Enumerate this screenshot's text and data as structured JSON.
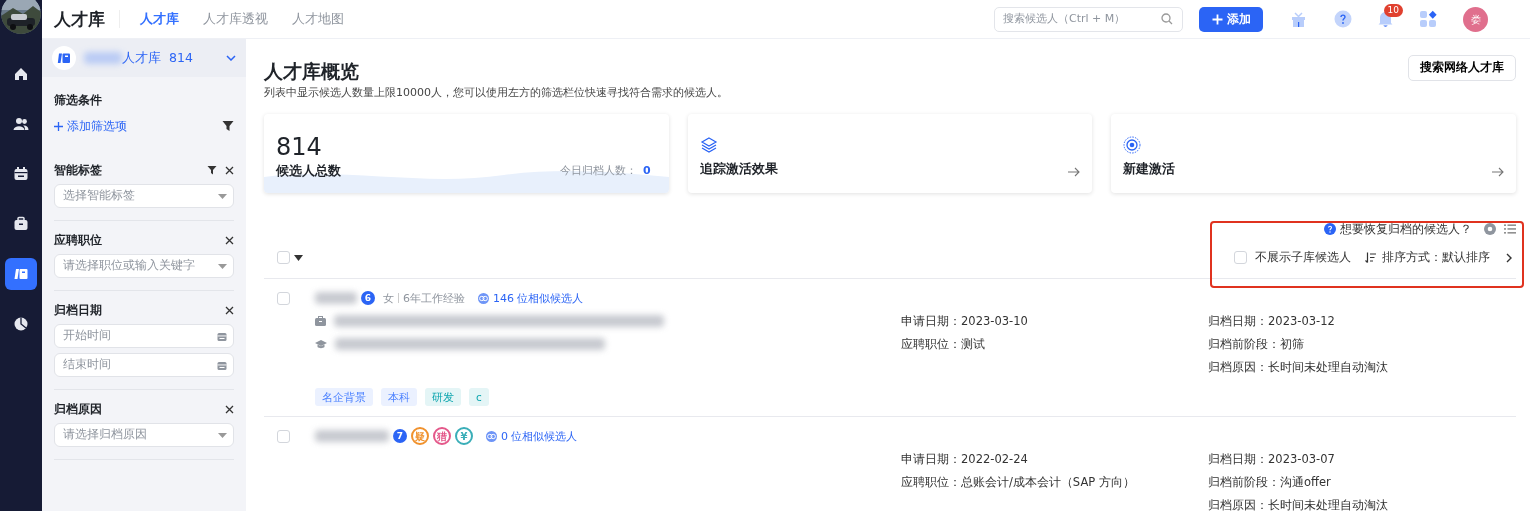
{
  "rail": {
    "items": [
      {
        "selected": false
      },
      {
        "selected": false
      },
      {
        "selected": false
      },
      {
        "selected": false
      },
      {
        "selected": true
      },
      {
        "selected": false
      }
    ]
  },
  "app_title": "人才库",
  "tabs": [
    {
      "label": "人才库",
      "selected": true
    },
    {
      "label": "人才库透视",
      "selected": false
    },
    {
      "label": "人才地图",
      "selected": false
    }
  ],
  "search": {
    "placeholder": "搜索候选人（Ctrl + M）"
  },
  "add_button": "添加",
  "notifications": {
    "badge": "10"
  },
  "user": {
    "avatar_text": "娄"
  },
  "sidebar": {
    "library": {
      "name": "人才库",
      "count": "814"
    },
    "filter_title": "筛选条件",
    "add_filter": "添加筛选项",
    "filters": [
      {
        "label": "智能标签",
        "filter_icon": true,
        "fields": [
          {
            "kind": "select",
            "placeholder": "选择智能标签"
          }
        ]
      },
      {
        "label": "应聘职位",
        "filter_icon": false,
        "fields": [
          {
            "kind": "select",
            "placeholder": "请选择职位或输入关键字"
          }
        ]
      },
      {
        "label": "归档日期",
        "filter_icon": false,
        "fields": [
          {
            "kind": "date",
            "placeholder": "开始时间"
          },
          {
            "kind": "date",
            "placeholder": "结束时间"
          }
        ]
      },
      {
        "label": "归档原因",
        "filter_icon": false,
        "fields": [
          {
            "kind": "select",
            "placeholder": "请选择归档原因"
          }
        ]
      }
    ]
  },
  "main": {
    "title": "人才库概览",
    "subtitle": "列表中显示候选人数量上限10000人，您可以使用左方的筛选栏位快速寻找符合需求的候选人。",
    "search_network_button": "搜索网络人才库",
    "cards": [
      {
        "kind": "total",
        "value": "814",
        "label": "候选人总数",
        "today_label": "今日归档人数：",
        "today_value": "0"
      },
      {
        "kind": "track",
        "label": "追踪激活效果"
      },
      {
        "kind": "new",
        "label": "新建激活"
      }
    ],
    "restore_link": "想要恢复归档的候选人？",
    "toolbar": {
      "select_all": {
        "checked": false
      },
      "hide_sub": {
        "label": "不展示子库候选人",
        "checked": false,
        "highlighted": true
      },
      "sort": {
        "label": "排序方式：默认排序"
      }
    },
    "candidates": [
      {
        "checked": false,
        "count": "6",
        "gender": "女",
        "experience": "6年工作经验",
        "similar": "146 位相似候选人",
        "details": [
          {
            "kind": "work"
          },
          {
            "kind": "education"
          }
        ],
        "fields_left": [
          "申请日期：2023-03-10",
          "应聘职位：测试"
        ],
        "fields_right": [
          "归档日期：2023-03-12",
          "归档前阶段：初筛",
          "归档原因：长时间未处理自动淘汰"
        ],
        "tags": [
          {
            "label": "名企背景",
            "color": "#ebf1ff"
          },
          {
            "label": "本科",
            "color": "#ebf1ff"
          },
          {
            "label": "研发",
            "color": "#e4f5f6"
          },
          {
            "label": "c",
            "color": "#e4f5f6"
          }
        ]
      },
      {
        "checked": false,
        "count": "7",
        "marks": [
          {
            "label": "疑",
            "color": "#f0922e"
          },
          {
            "label": "猎",
            "color": "#e4588a"
          },
          {
            "label": "¥",
            "color": "#3aaeb8"
          }
        ],
        "similar": "0 位相似候选人",
        "fields_left": [
          "申请日期：2022-02-24",
          "应聘职位：总账会计/成本会计（SAP 方向）"
        ],
        "fields_right": [
          "归档日期：2023-03-07",
          "归档前阶段：沟通offer",
          "归档原因：长时间未处理自动淘汰"
        ]
      }
    ]
  }
}
